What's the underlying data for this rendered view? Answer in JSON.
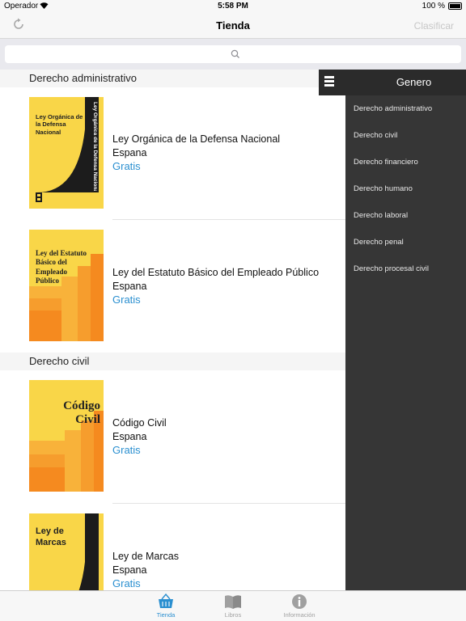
{
  "status_bar": {
    "carrier": "Operador",
    "time": "5:58 PM",
    "battery": "100 %"
  },
  "nav": {
    "title": "Tienda",
    "sort_label": "Clasificar"
  },
  "sections": [
    {
      "header": "Derecho administrativo",
      "items": [
        {
          "title": "Ley Orgánica de la Defensa Nacional",
          "country": "Espana",
          "price": "Gratis",
          "cover_title": "Ley Orgánica de la Defensa Nacional",
          "cover_spine": "Ley Orgánica de la Defensa Nacional"
        },
        {
          "title": "Ley del Estatuto Básico del Empleado Público",
          "country": "Espana",
          "price": "Gratis",
          "cover_title": "Ley del Estatuto Básico del Empleado Público"
        }
      ]
    },
    {
      "header": "Derecho civil",
      "items": [
        {
          "title": "Código Civil",
          "country": "Espana",
          "price": "Gratis",
          "cover_title": "Código Civil"
        },
        {
          "title": "Ley de Marcas",
          "country": "Espana",
          "price": "Gratis",
          "cover_title": "Ley de Marcas"
        }
      ]
    }
  ],
  "drawer": {
    "title": "Genero",
    "items": [
      "Derecho administrativo",
      "Derecho civil",
      "Derecho financiero",
      "Derecho humano",
      "Derecho laboral",
      "Derecho penal",
      "Derecho procesal civil"
    ]
  },
  "tabs": [
    {
      "label": "Tienda",
      "icon": "basket-icon",
      "active": true
    },
    {
      "label": "Libros",
      "icon": "book-icon",
      "active": false
    },
    {
      "label": "Información",
      "icon": "info-icon",
      "active": false
    }
  ],
  "colors": {
    "accent": "#2a8fd0",
    "cover_yellow": "#f9d648",
    "cover_orange": "#f58a1f",
    "drawer_bg": "#363636"
  }
}
